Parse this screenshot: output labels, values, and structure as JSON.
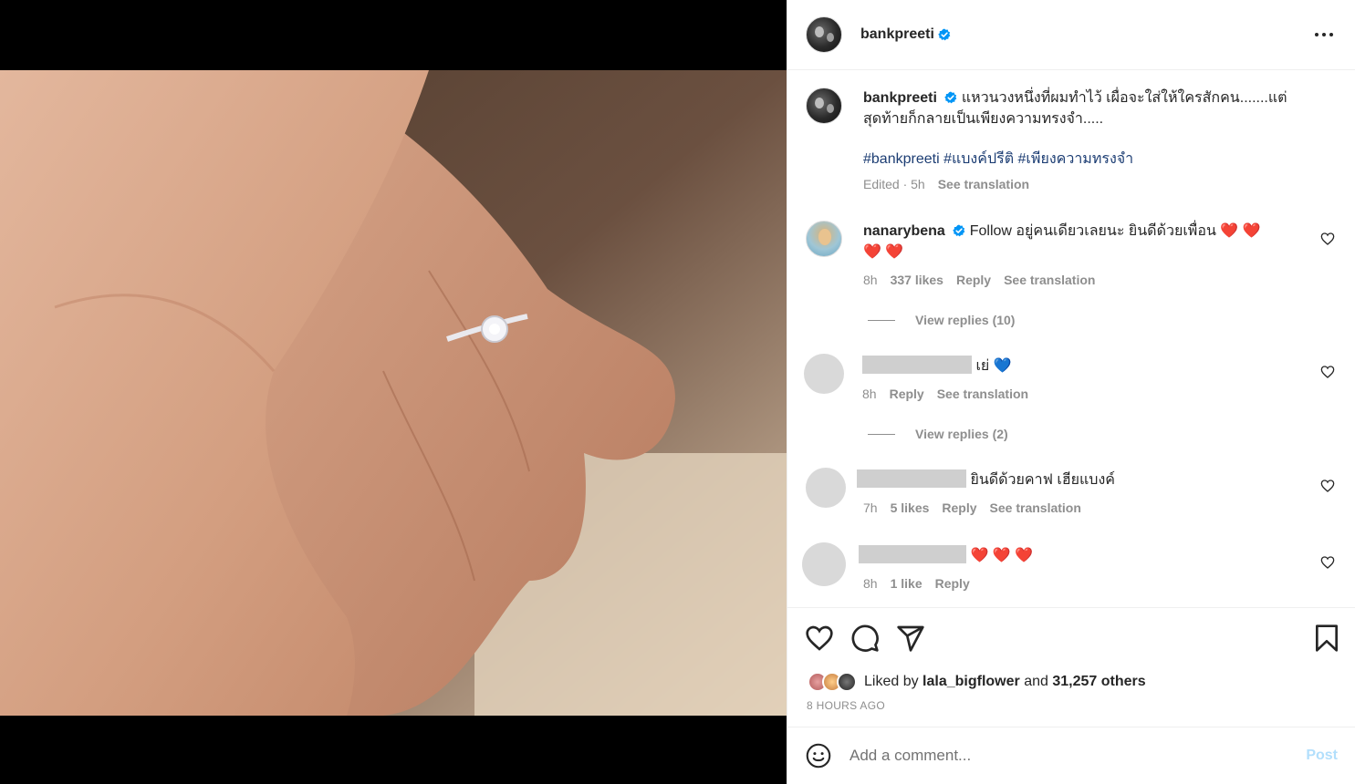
{
  "post": {
    "username": "bankpreeti",
    "more_icon": "more-horizontal-icon",
    "caption_text": "แหวนวงหนึ่งที่ผมทำไว้ เผื่อจะใส่ให้ใครสักคน.......แต่สุดท้ายก็กลายเป็นเพียงความทรงจำ.....",
    "hashtags": "#bankpreeti #แบงค์ปรีติ #เพียงความทรงจำ",
    "caption_meta_time": "Edited · 5h",
    "see_translation": "See translation"
  },
  "comments": [
    {
      "username": "nanarybena",
      "text": "Follow อยู่คนเดียวเลยนะ ยินดีด้วยเพื่อน ❤️ ❤️ ❤️ ❤️",
      "time": "8h",
      "likes": "337 likes",
      "reply": "Reply",
      "translation": "See translation",
      "view_replies": "View replies (10)"
    },
    {
      "text": "เย่ 💙",
      "time": "8h",
      "reply": "Reply",
      "translation": "See translation",
      "view_replies": "View replies (2)"
    },
    {
      "text": "ยินดีด้วยคาฟ เฮียแบงค์",
      "time": "7h",
      "likes": "5 likes",
      "reply": "Reply",
      "translation": "See translation"
    },
    {
      "text": "❤️ ❤️ ❤️",
      "time": "8h",
      "likes": "1 like",
      "reply": "Reply"
    }
  ],
  "actions": {
    "liked_prefix": "Liked by",
    "liked_user": "lala_bigflower",
    "liked_and": "and",
    "liked_others": "31,257 others",
    "time_ago": "8 HOURS AGO"
  },
  "composer": {
    "placeholder": "Add a comment...",
    "post_label": "Post",
    "emoji_icon": "smiley-icon"
  },
  "colors": {
    "verified": "#0095f6",
    "hashtag": "#1c3d73",
    "muted": "#8e8e8e",
    "post_disabled": "#b2dffc"
  }
}
